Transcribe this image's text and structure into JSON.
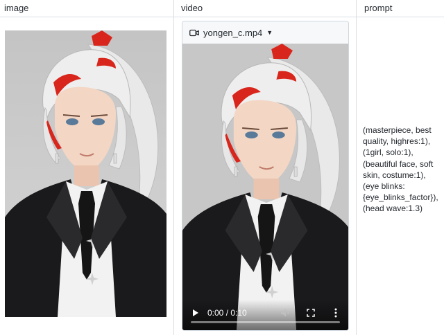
{
  "columns": {
    "image": "image",
    "video": "video",
    "prompt": "prompt"
  },
  "video": {
    "filename": "yongen_c.mp4",
    "time_display": "0:00 / 0:10",
    "progress": 0
  },
  "prompt": {
    "text": "(masterpiece, best quality, highres:1), (1girl, solo:1), (beautiful face, soft skin, costume:1), (eye blinks: {eye_blinks_factor}), (head wave:1.3)"
  },
  "icons": [
    "video-camera-icon",
    "caret-down-icon",
    "play-icon",
    "mute-icon",
    "fullscreen-icon",
    "more-vert-icon"
  ]
}
